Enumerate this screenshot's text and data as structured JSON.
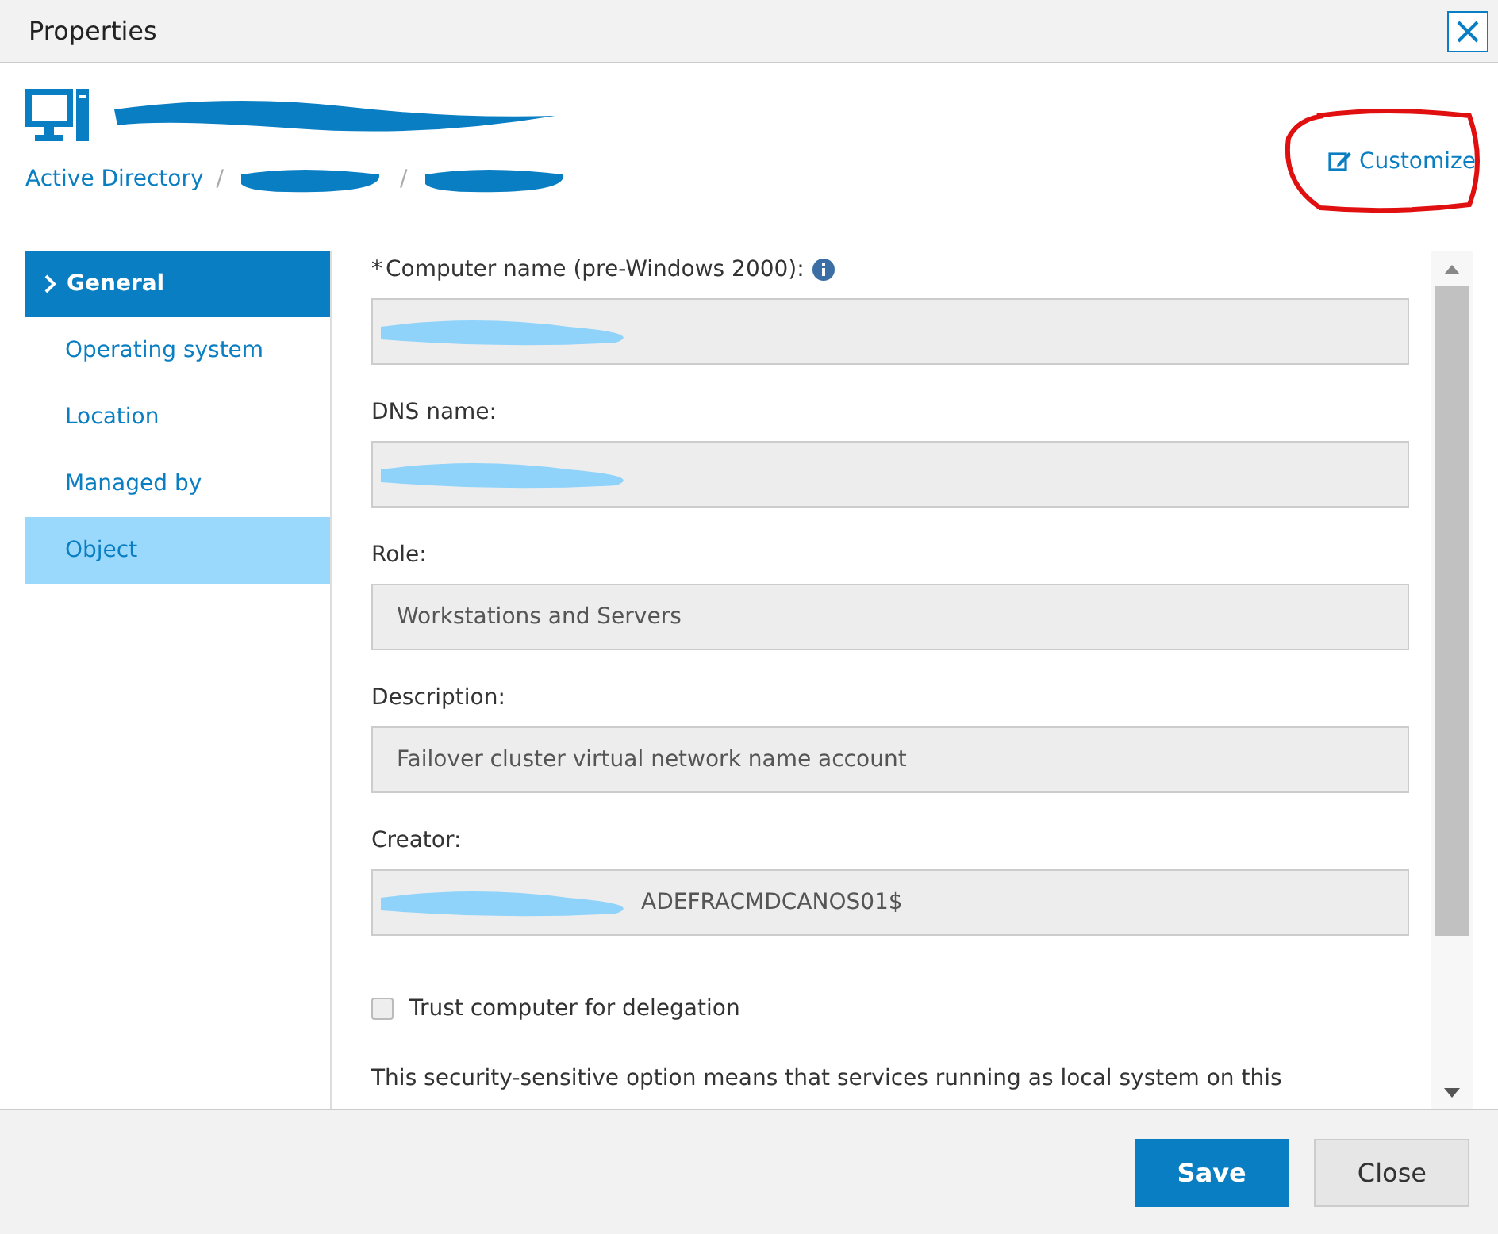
{
  "window": {
    "title": "Properties"
  },
  "header": {
    "title_redacted": true,
    "breadcrumb": [
      {
        "kind": "link",
        "label": "Active Directory"
      },
      {
        "kind": "separator",
        "label": "/"
      },
      {
        "kind": "redacted"
      },
      {
        "kind": "separator",
        "label": "/"
      },
      {
        "kind": "redacted"
      }
    ],
    "customize": {
      "label": "Customize",
      "circled": true
    }
  },
  "sidebar": {
    "items": [
      {
        "label": "General",
        "selected": true,
        "highlighted": false
      },
      {
        "label": "Operating system",
        "selected": false,
        "highlighted": false
      },
      {
        "label": "Location",
        "selected": false,
        "highlighted": false
      },
      {
        "label": "Managed by",
        "selected": false,
        "highlighted": false
      },
      {
        "label": "Object",
        "selected": false,
        "highlighted": true
      }
    ]
  },
  "fields": [
    {
      "kind": "text",
      "required_mark": "*",
      "label": "Computer name (pre-Windows 2000):",
      "info": true,
      "redacted": true
    },
    {
      "kind": "text",
      "label": "DNS name:",
      "info": false,
      "redacted": true
    },
    {
      "kind": "text",
      "label": "Role:",
      "info": false,
      "value": "Workstations and Servers",
      "redacted": false
    },
    {
      "kind": "text",
      "label": "Description:",
      "info": false,
      "value": "Failover cluster virtual network name account",
      "redacted": false
    },
    {
      "kind": "text",
      "label": "Creator:",
      "info": false,
      "value": "ADEFRACMDCANOS01$",
      "redacted": true
    },
    {
      "kind": "checkbox",
      "label": "Trust computer for delegation",
      "checked": false
    },
    {
      "kind": "note",
      "label": "This security-sensitive option means that services running as local system on this"
    }
  ],
  "buttons": [
    {
      "label": "Save",
      "primary": true
    },
    {
      "label": "Close",
      "primary": false
    }
  ]
}
